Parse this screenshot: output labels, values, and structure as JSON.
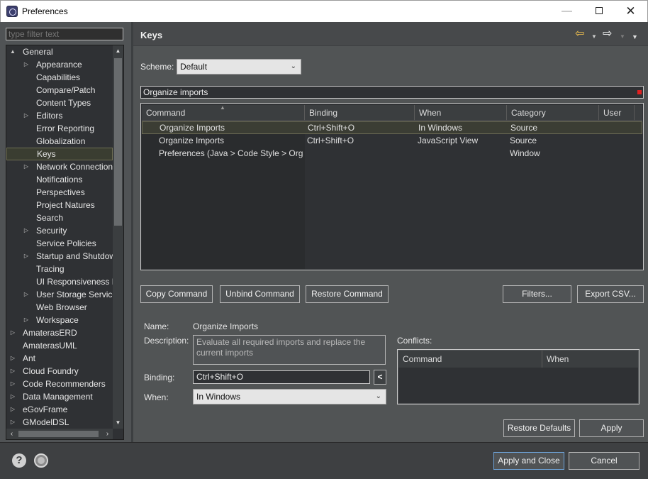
{
  "window": {
    "title": "Preferences"
  },
  "filter": {
    "placeholder": "type filter text"
  },
  "tree": {
    "items": [
      {
        "label": "General",
        "twisty": "▲",
        "level": 0
      },
      {
        "label": "Appearance",
        "twisty": "▷",
        "level": 1
      },
      {
        "label": "Capabilities",
        "twisty": "",
        "level": 1
      },
      {
        "label": "Compare/Patch",
        "twisty": "",
        "level": 1
      },
      {
        "label": "Content Types",
        "twisty": "",
        "level": 1
      },
      {
        "label": "Editors",
        "twisty": "▷",
        "level": 1
      },
      {
        "label": "Error Reporting",
        "twisty": "",
        "level": 1
      },
      {
        "label": "Globalization",
        "twisty": "",
        "level": 1
      },
      {
        "label": "Keys",
        "twisty": "",
        "level": 1,
        "selected": true
      },
      {
        "label": "Network Connections",
        "twisty": "▷",
        "level": 1
      },
      {
        "label": "Notifications",
        "twisty": "",
        "level": 1
      },
      {
        "label": "Perspectives",
        "twisty": "",
        "level": 1
      },
      {
        "label": "Project Natures",
        "twisty": "",
        "level": 1
      },
      {
        "label": "Search",
        "twisty": "",
        "level": 1
      },
      {
        "label": "Security",
        "twisty": "▷",
        "level": 1
      },
      {
        "label": "Service Policies",
        "twisty": "",
        "level": 1
      },
      {
        "label": "Startup and Shutdown",
        "twisty": "▷",
        "level": 1
      },
      {
        "label": "Tracing",
        "twisty": "",
        "level": 1
      },
      {
        "label": "UI Responsiveness Monitoring",
        "twisty": "",
        "level": 1
      },
      {
        "label": "User Storage Service",
        "twisty": "▷",
        "level": 1
      },
      {
        "label": "Web Browser",
        "twisty": "",
        "level": 1
      },
      {
        "label": "Workspace",
        "twisty": "▷",
        "level": 1
      },
      {
        "label": "AmaterasERD",
        "twisty": "▷",
        "level": 0
      },
      {
        "label": "AmaterasUML",
        "twisty": "",
        "level": 0
      },
      {
        "label": "Ant",
        "twisty": "▷",
        "level": 0
      },
      {
        "label": "Cloud Foundry",
        "twisty": "▷",
        "level": 0
      },
      {
        "label": "Code Recommenders",
        "twisty": "▷",
        "level": 0
      },
      {
        "label": "Data Management",
        "twisty": "▷",
        "level": 0
      },
      {
        "label": "eGovFrame",
        "twisty": "▷",
        "level": 0
      },
      {
        "label": "GModelDSL",
        "twisty": "▷",
        "level": 0
      }
    ]
  },
  "page": {
    "title": "Keys"
  },
  "scheme": {
    "label": "Scheme:",
    "value": "Default"
  },
  "search": {
    "value": "Organize imports"
  },
  "table": {
    "headers": {
      "command": "Command",
      "binding": "Binding",
      "when": "When",
      "category": "Category",
      "user": "User"
    },
    "rows": [
      {
        "command": "Organize Imports",
        "binding": "Ctrl+Shift+O",
        "when": "In Windows",
        "category": "Source",
        "user": "",
        "selected": true
      },
      {
        "command": "Organize Imports",
        "binding": "Ctrl+Shift+O",
        "when": "JavaScript View",
        "category": "Source",
        "user": ""
      },
      {
        "command": "Preferences (Java > Code Style > Organize Imports)",
        "binding": "",
        "when": "",
        "category": "Window",
        "user": ""
      }
    ]
  },
  "buttons": {
    "copy_command": "Copy Command",
    "unbind_command": "Unbind Command",
    "restore_command": "Restore Command",
    "filters": "Filters...",
    "export_csv": "Export CSV...",
    "restore_defaults": "Restore Defaults",
    "apply": "Apply",
    "apply_and_close": "Apply and Close",
    "cancel": "Cancel",
    "binding_backspace": "<"
  },
  "details": {
    "name_label": "Name:",
    "name_value": "Organize Imports",
    "description_label": "Description:",
    "description_value": "Evaluate all required imports and replace the current imports",
    "binding_label": "Binding:",
    "binding_value": "Ctrl+Shift+O",
    "when_label": "When:",
    "when_value": "In Windows"
  },
  "conflicts": {
    "label": "Conflicts:",
    "headers": {
      "command": "Command",
      "when": "When"
    }
  },
  "icons": {
    "help": "?",
    "back": "⇦",
    "forward": "⇨",
    "menu_dropdown": "▼",
    "chevron_down": "⌄"
  },
  "colors": {
    "accent_focus": "#6ea3d8",
    "nav_back": "#f2c14e",
    "filter_clear_marker": "#e02020"
  }
}
